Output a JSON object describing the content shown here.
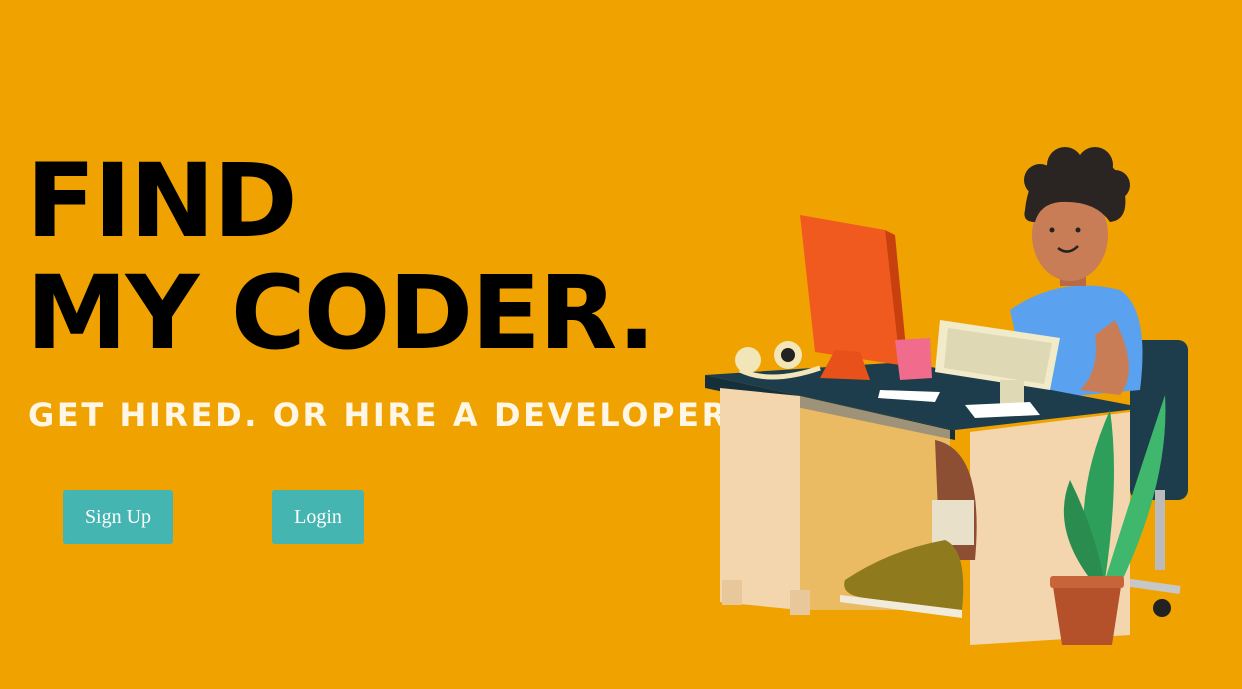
{
  "hero": {
    "title_line1": "FIND",
    "title_line2": "MY CODER.",
    "tagline": "GET HIRED. OR HIRE A DEVELOPER."
  },
  "actions": {
    "signup_label": "Sign Up",
    "login_label": "Login"
  },
  "colors": {
    "background": "#F0A300",
    "button": "#45B5B2",
    "title": "#000000",
    "tagline": "#FFF6E6"
  },
  "illustration": {
    "icon": "developer-at-desk-icon"
  }
}
